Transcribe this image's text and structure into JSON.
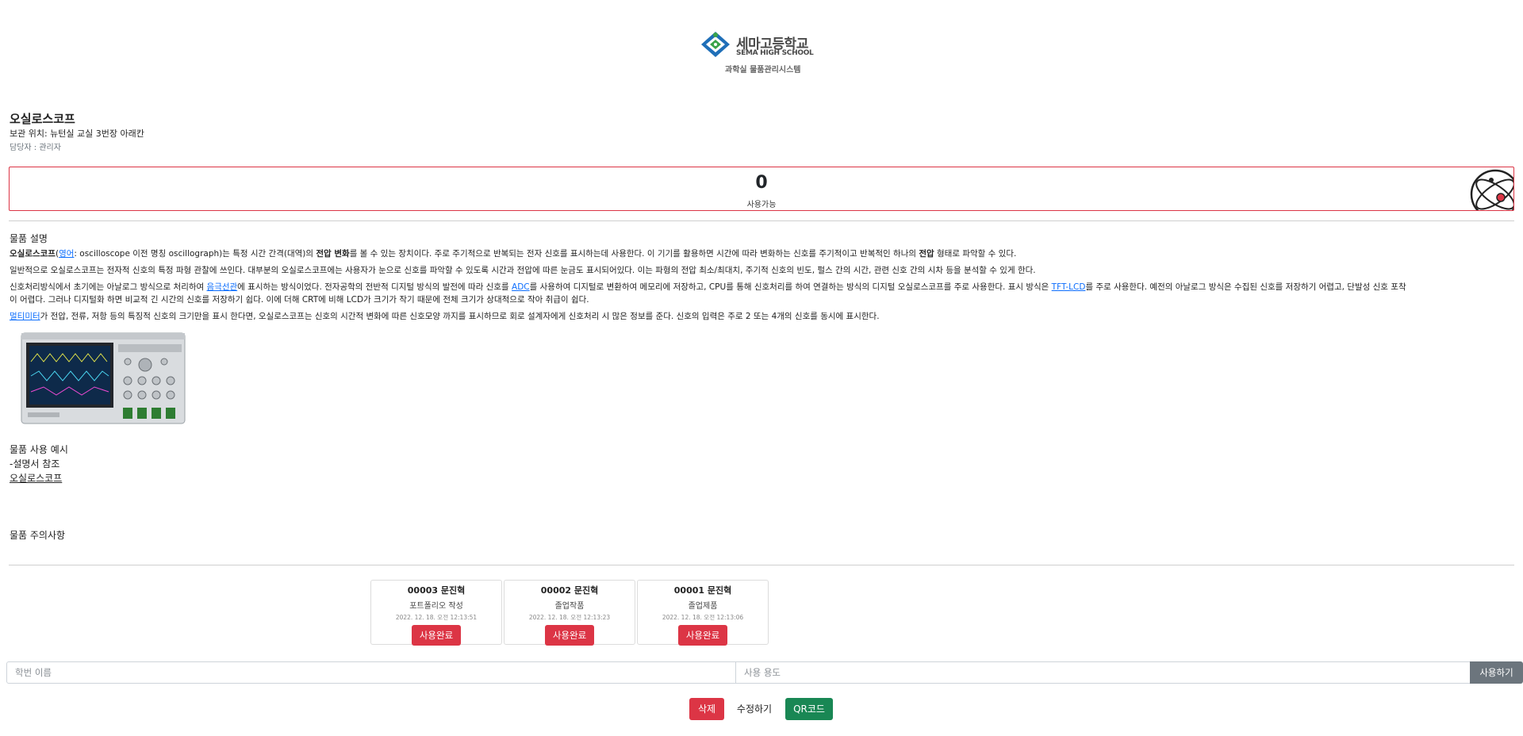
{
  "header": {
    "logo_name_ko": "세마고등학교",
    "logo_name_en": "SEMA HIGH SCHOOL",
    "subtitle": "과학실 물품관리시스템"
  },
  "item": {
    "title": "오실로스코프",
    "location": "보관 위치: 뉴턴실 교실 3번장 아래칸",
    "manager": "담당자 : 관리자"
  },
  "availability": {
    "count": "0",
    "label": "사용가능",
    "icon": "atom-icon"
  },
  "description": {
    "title": "물품 설명",
    "p1": {
      "term": "오실로스코프",
      "lang_link": "영어",
      "rest_a": ": oscilloscope 이전 명칭 oscillograph)는 특정 시간 간격(대역)의 ",
      "bold_a": "전압 변화",
      "rest_b": "를 볼 수 있는 장치이다. 주로 주기적으로 반복되는 전자 신호를 표시하는데 사용한다. 이 기기를 활용하면 시간에 따라 변화하는 신호를 주기적이고 반복적인 하나의 ",
      "bold_b": "전압",
      "rest_c": " 형태로 파악할 수 있다."
    },
    "p2": "일반적으로 오실로스코프는 전자적 신호의 특정 파형 관찰에 쓰인다. 대부분의 오실로스코프에는 사용자가 눈으로 신호를 파악할 수 있도록 시간과 전압에 따른 눈금도 표시되어있다. 이는 파형의 전압 최소/최대치, 주기적 신호의 빈도, 펄스 간의 시간, 관련 신호 간의 시차 등을 분석할 수 있게 한다.",
    "p3": {
      "a": "신호처리방식에서 초기에는 아날로그 방식으로 처리하여 ",
      "link1": "음극선관",
      "b": "에 표시하는 방식이었다. 전자공학의 전반적 디지털 방식의 발전에 따라 신호를 ",
      "link2": "ADC",
      "c": "를 사용하여 디지털로 변환하여 메모리에 저장하고, CPU를 통해 신호처리를 하여 연결하는 방식의 디지털 오실로스코프를 주로 사용한다. 표시 방식은 ",
      "link3": "TFT-LCD",
      "d": "를 주로 사용한다. 예전의 아날로그 방식은 수집된 신호를 저장하기 어렵고, 단발성 신호 포착",
      "line2": "이 어렵다. 그러나 디지털화 하면 비교적 긴 시간의 신호를 저장하기 쉽다. 이에 더해 CRT에 비해 LCD가 크기가 작기 때문에 전체 크기가 상대적으로 작아 취급이 쉽다."
    },
    "p4": {
      "link": "멀티미터",
      "rest": "가 전압, 전류, 저항 등의 특징적 신호의 크기만을 표시 한다면, 오실로스코프는 신호의 시간적 변화에 따른 신호모양 까지를 표시하므로 회로 설계자에게 신호처리 시 많은 정보를 준다. 신호의 입력은 주로 2 또는 4개의 신호를 동시에 표시한다."
    }
  },
  "usage": {
    "title": "물품 사용 예시",
    "note": "-설명서 참조",
    "link": "오실로스코프"
  },
  "caution": {
    "title": "물품 주의사항"
  },
  "history": [
    {
      "header": "00003 문진혁",
      "purpose": "포트폴리오 작성",
      "time": "2022. 12. 18. 오전 12:13:51",
      "button": "사용완료"
    },
    {
      "header": "00002 문진혁",
      "purpose": "졸업작품",
      "time": "2022. 12. 18. 오전 12:13:23",
      "button": "사용완료"
    },
    {
      "header": "00001 문진혁",
      "purpose": "졸업제품",
      "time": "2022. 12. 18. 오전 12:13:06",
      "button": "사용완료"
    }
  ],
  "form": {
    "name_placeholder": "학번 이름",
    "purpose_placeholder": "사용 용도",
    "submit_label": "사용하기"
  },
  "actions": {
    "delete_label": "삭제",
    "edit_label": "수정하기",
    "qr_label": "QR코드"
  },
  "colors": {
    "danger": "#dc3545",
    "secondary": "#6c757d",
    "success": "#198754",
    "link": "#0d6efd",
    "logo_blue": "#1f6fb8",
    "logo_green": "#3aa34a"
  }
}
